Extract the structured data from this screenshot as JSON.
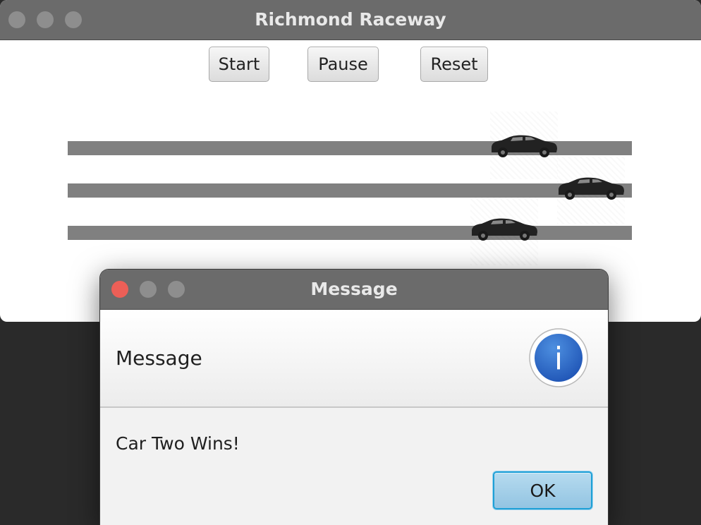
{
  "main_window": {
    "title": "Richmond Raceway",
    "traffic_lights": [
      "close",
      "minimize",
      "zoom"
    ],
    "toolbar": {
      "start_label": "Start",
      "pause_label": "Pause",
      "reset_label": "Reset"
    },
    "track": {
      "lane_color": "#808080",
      "cars": [
        "car-one",
        "car-two",
        "car-three"
      ],
      "car_progress": [
        0.73,
        0.85,
        0.69
      ]
    }
  },
  "dialog": {
    "title": "Message",
    "header_text": "Message",
    "icon": "info-icon",
    "icon_glyph": "i",
    "content": "Car Two Wins!",
    "ok_label": "OK"
  },
  "colors": {
    "titlebar": "#6b6b6b",
    "traffic_inactive": "#8e8e8e",
    "traffic_close": "#ec5f57",
    "info_blue": "#2f6fcb",
    "ok_focus": "#1ea0d6"
  }
}
